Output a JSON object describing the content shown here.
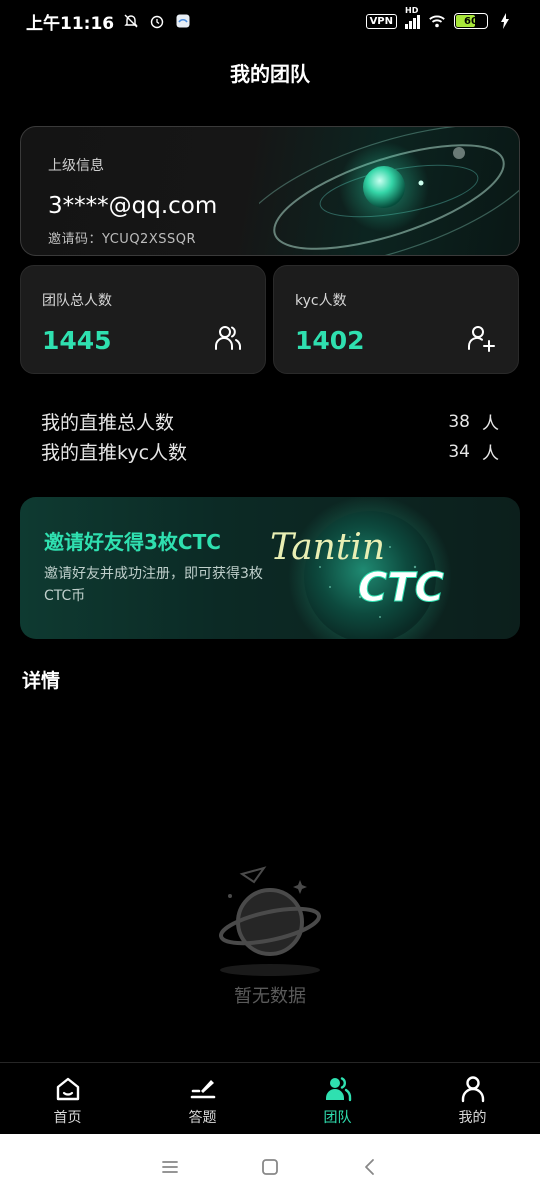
{
  "status_bar": {
    "time": "上午11:16",
    "vpn": "VPN",
    "hd": "HD",
    "battery": "60"
  },
  "page": {
    "title": "我的团队"
  },
  "superior": {
    "label": "上级信息",
    "email": "3****@qq.com",
    "invite_code": "邀请码：YCUQ2XSSQR"
  },
  "stats": {
    "team_total": {
      "label": "团队总人数",
      "value": "1445",
      "icon": "users-icon"
    },
    "kyc_total": {
      "label": "kyc人数",
      "value": "1402",
      "icon": "user-add-icon"
    }
  },
  "direct": [
    {
      "label": "我的直推总人数",
      "value": "38",
      "unit": "人"
    },
    {
      "label": "我的直推kyc人数",
      "value": "34",
      "unit": "人"
    }
  ],
  "banner": {
    "title": "邀请好友得3枚CTC",
    "desc": "邀请好友并成功注册，即可获得3枚CTC币",
    "logo_script": "Tantin",
    "logo_ctc": "CTC"
  },
  "details": {
    "title": "详情",
    "empty_text": "暂无数据"
  },
  "nav": [
    {
      "label": "首页",
      "icon": "home-icon",
      "active": false
    },
    {
      "label": "答题",
      "icon": "quiz-icon",
      "active": false
    },
    {
      "label": "团队",
      "icon": "team-icon",
      "active": true
    },
    {
      "label": "我的",
      "icon": "profile-icon",
      "active": false
    }
  ],
  "colors": {
    "accent": "#2fe0b0",
    "background": "#000000",
    "card": "#1c1c1c"
  }
}
